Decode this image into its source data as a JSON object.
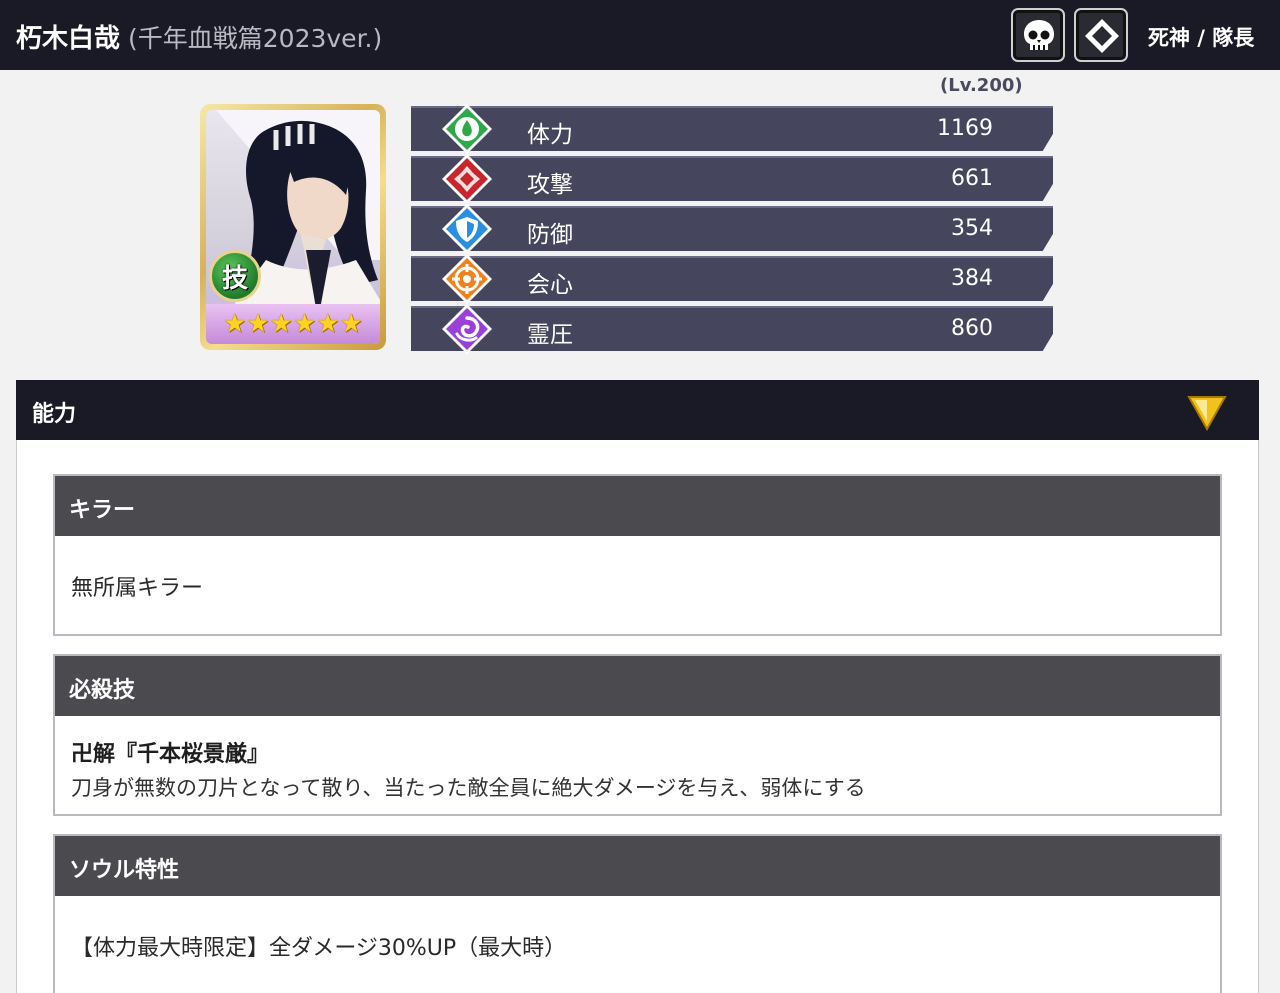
{
  "header": {
    "name": "朽木白哉",
    "version": "(千年血戦篇2023ver.)",
    "class_text": "死神 / 隊長",
    "icons": [
      "skull-icon",
      "diamond-icon"
    ]
  },
  "level": "(Lv.200)",
  "portrait": {
    "skill_badge": "技",
    "stars": "★★★★★★"
  },
  "stats": [
    {
      "label": "体力",
      "value": "1169",
      "icon": "hp-icon",
      "color": "#2fa84a"
    },
    {
      "label": "攻撃",
      "value": "661",
      "icon": "attack-icon",
      "color": "#c8262c"
    },
    {
      "label": "防御",
      "value": "354",
      "icon": "defense-icon",
      "color": "#2b8fe0"
    },
    {
      "label": "会心",
      "value": "384",
      "icon": "critical-icon",
      "color": "#f0821e"
    },
    {
      "label": "霊圧",
      "value": "860",
      "icon": "spirit-icon",
      "color": "#9a3fd8"
    }
  ],
  "ability": {
    "title": "能力",
    "cards": {
      "killer": {
        "title": "キラー",
        "text": "無所属キラー"
      },
      "special": {
        "title": "必殺技",
        "name": "卍解『千本桜景厳』",
        "desc": "刀身が無数の刀片となって散り、当たった敵全員に絶大ダメージを与え、弱体にする"
      },
      "soul": {
        "title": "ソウル特性",
        "text": "【体力最大時限定】全ダメージ30%UP（最大時）"
      }
    }
  },
  "colors": {
    "header_bg": "#1a1a26",
    "stat_bg": "#45455e",
    "card_head_bg": "#4b4b4f",
    "toggle_gold": "#f2c21c"
  }
}
